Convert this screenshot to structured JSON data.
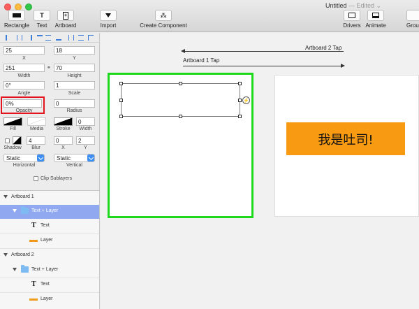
{
  "window": {
    "title": "Untitled",
    "status": "— Edited ⌄"
  },
  "toolbar": {
    "rectangle": "Rectangle",
    "text": "Text",
    "artboard": "Artboard",
    "import": "Import",
    "create_component": "Create Component",
    "drivers": "Drivers",
    "animate": "Animate",
    "group": "Grou"
  },
  "inspector": {
    "x_value": "25",
    "x_label": "X",
    "y_value": "18",
    "y_label": "Y",
    "width_value": "251",
    "width_label": "Width",
    "height_value": "70",
    "height_label": "Height",
    "angle_value": "0°",
    "angle_label": "Angle",
    "scale_value": "1",
    "scale_label": "Scale",
    "opacity_value": "0%",
    "opacity_label": "Opacity",
    "radius_value": "0",
    "radius_label": "Radius",
    "fill_label": "Fill",
    "media_label": "Media",
    "stroke_label": "Stroke",
    "stroke_width_value": "0",
    "stroke_width_label": "Width",
    "shadow_label": "Shadow",
    "blur_value": "4",
    "blur_label": "Blur",
    "shadow_x_value": "0",
    "shadow_x_label": "X",
    "shadow_y_value": "2",
    "shadow_y_label": "Y",
    "horizontal_value": "Static",
    "horizontal_label": "Horizontal",
    "vertical_value": "Static",
    "vertical_label": "Vertical",
    "clip_label": "Clip Sublayers"
  },
  "layers": [
    {
      "label": "Artboard 1"
    },
    {
      "label": "Text + Layer"
    },
    {
      "label": "Text"
    },
    {
      "label": "Layer"
    },
    {
      "label": "Artboard 2"
    },
    {
      "label": "Text + Layer"
    },
    {
      "label": "Text"
    },
    {
      "label": "Layer"
    }
  ],
  "canvas": {
    "artboard2_tap": "Artboard 2 Tap",
    "artboard1_tap": "Artboard 1 Tap",
    "button_text": "我是吐司!"
  },
  "colors": {
    "selected_artboard": "#1ed81e",
    "accent": "#f89a12",
    "highlight": "#e3141b",
    "selection_row": "#90a8f0"
  }
}
